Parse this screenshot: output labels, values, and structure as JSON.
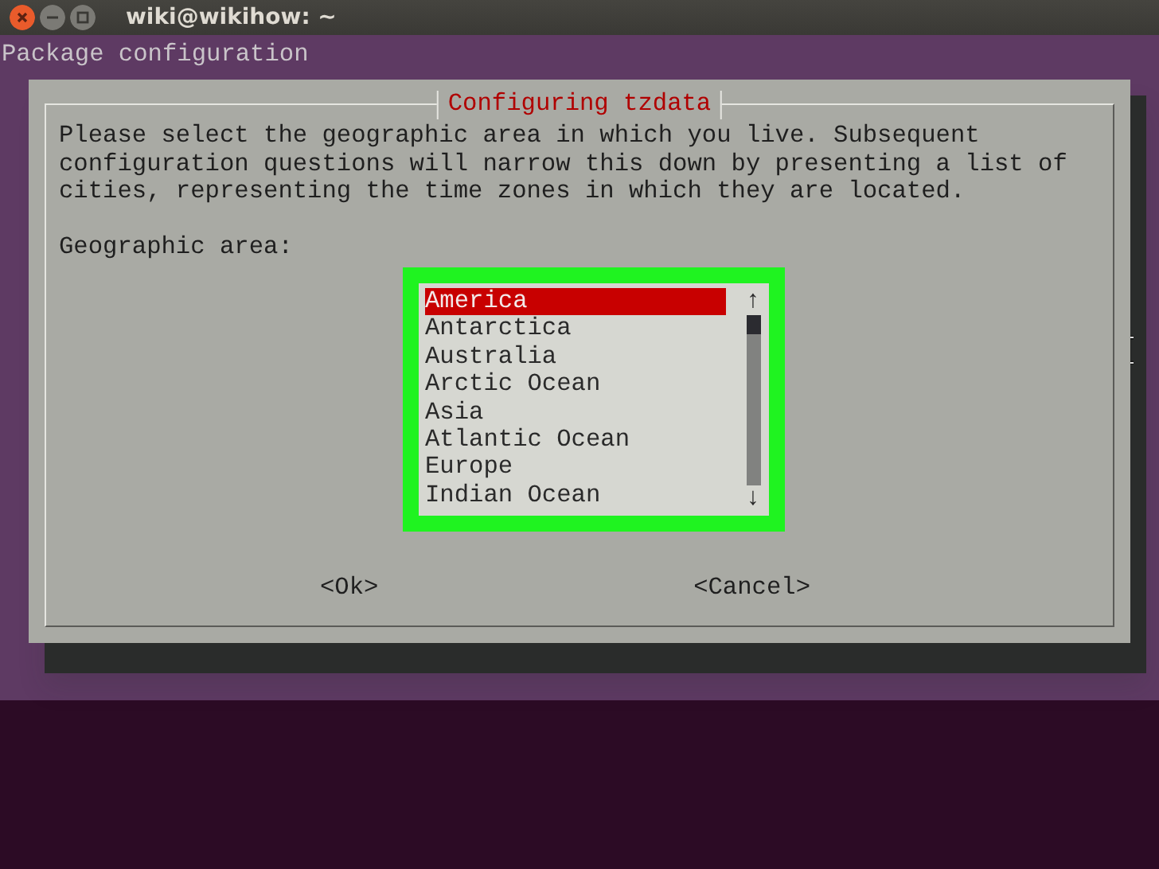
{
  "window": {
    "title": "wiki@wikihow: ~"
  },
  "terminal": {
    "header": "Package configuration"
  },
  "dialog": {
    "title": "Configuring tzdata",
    "message": "Please select the geographic area in which you live. Subsequent\nconfiguration questions will narrow this down by presenting a list of\ncities, representing the time zones in which they are located.",
    "prompt": "Geographic area:",
    "list": {
      "scroll_up": "↑",
      "scroll_down": "↓",
      "items": [
        {
          "label": "America",
          "selected": true
        },
        {
          "label": "Antarctica",
          "selected": false
        },
        {
          "label": "Australia",
          "selected": false
        },
        {
          "label": "Arctic Ocean",
          "selected": false
        },
        {
          "label": "Asia",
          "selected": false
        },
        {
          "label": "Atlantic Ocean",
          "selected": false
        },
        {
          "label": "Europe",
          "selected": false
        },
        {
          "label": "Indian Ocean",
          "selected": false
        }
      ]
    },
    "buttons": [
      {
        "label": "<Ok>",
        "selected": false
      },
      {
        "label": "<Cancel>",
        "selected": false
      }
    ]
  }
}
